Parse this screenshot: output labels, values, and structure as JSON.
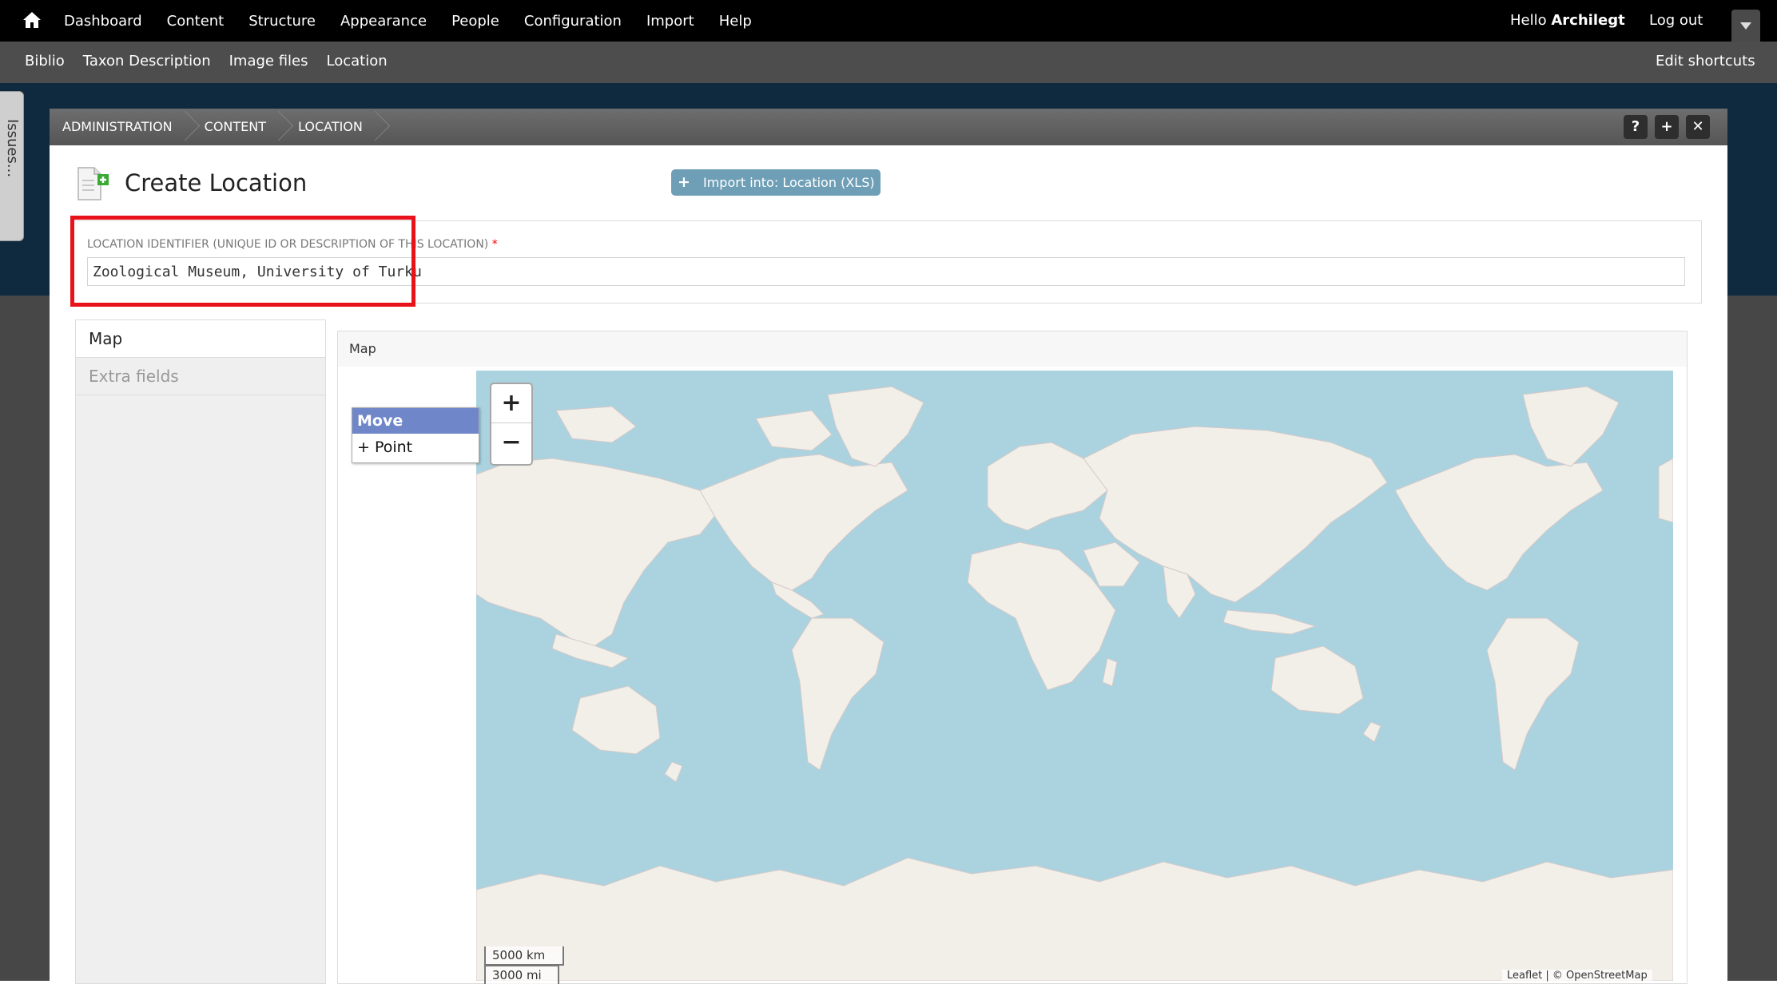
{
  "toolbar": {
    "menu": [
      "Dashboard",
      "Content",
      "Structure",
      "Appearance",
      "People",
      "Configuration",
      "Import",
      "Help"
    ],
    "hello_prefix": "Hello ",
    "username": "Archilegt",
    "logout": "Log out"
  },
  "shortcuts": {
    "links": [
      "Biblio",
      "Taxon Description",
      "Image files",
      "Location"
    ],
    "edit": "Edit shortcuts"
  },
  "issues_tab": "Issues...",
  "overlay": {
    "breadcrumbs": [
      "Administration",
      "Content",
      "Location"
    ],
    "buttons": [
      "?",
      "+",
      "✕"
    ]
  },
  "page": {
    "title": "Create Location",
    "import_label": "Import into: Location (XLS)"
  },
  "location_field": {
    "label": "Location identifier (unique ID or description of this location)",
    "required_marker": "*",
    "value": "Zoological Museum, University of Turku"
  },
  "vertical_tabs": [
    "Map",
    "Extra fields"
  ],
  "map_fieldset": {
    "legend": "Map"
  },
  "map": {
    "tools": [
      "Move",
      "+ Point"
    ],
    "zoom_in": "+",
    "zoom_out": "−",
    "scale_km": "5000 km",
    "scale_mi": "3000 mi",
    "attribution": "Leaflet | © OpenStreetMap",
    "water_color": "#aad3df",
    "land_color": "#f2efe9"
  },
  "colors": {
    "highlight": "#e8131a",
    "import_button": "#6e9fb6",
    "active_tool": "#6f87c9"
  }
}
